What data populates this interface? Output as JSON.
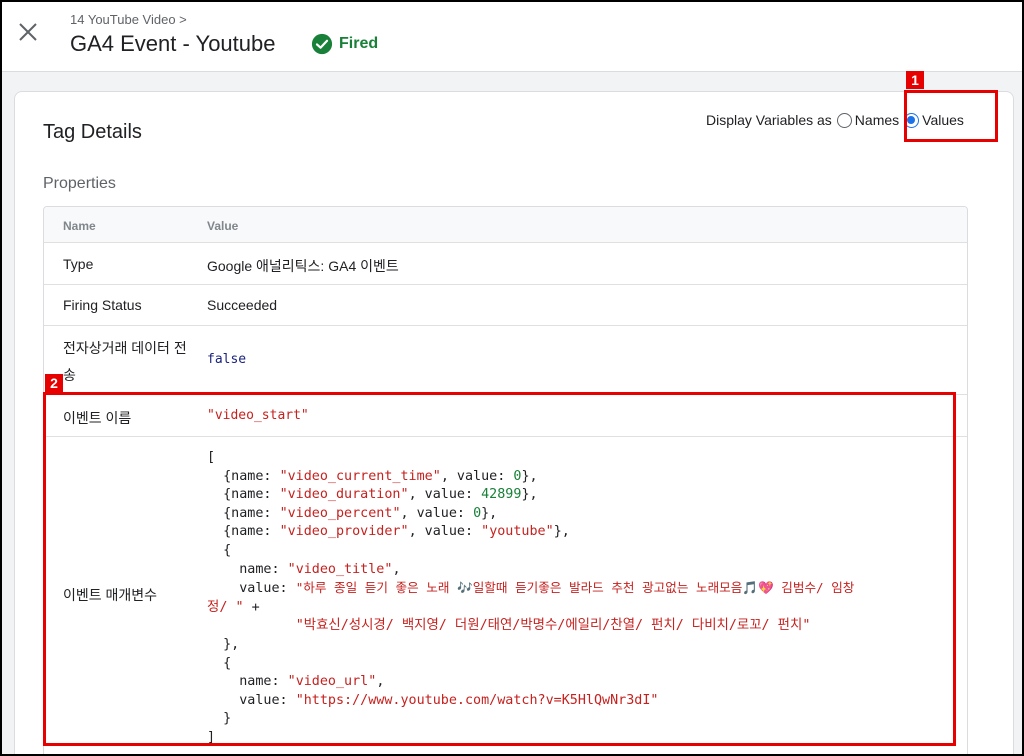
{
  "header": {
    "breadcrumb": "14 YouTube Video >",
    "title": "GA4 Event - Youtube",
    "status": "Fired",
    "status_color": "#188038"
  },
  "card": {
    "title": "Tag Details",
    "display_variables": {
      "label": "Display Variables as",
      "options": [
        "Names",
        "Values"
      ],
      "selected": "Values"
    },
    "section": "Properties",
    "table": {
      "columns": [
        "Name",
        "Value"
      ],
      "rows": [
        {
          "name": "Type",
          "value": "Google 애널리틱스: GA4 이벤트"
        },
        {
          "name": "Firing Status",
          "value": "Succeeded"
        },
        {
          "name": "전자상거래 데이터 전",
          "name_cont": "송",
          "value": "false"
        },
        {
          "name": "이벤트 이름",
          "value": "\"video_start\""
        },
        {
          "name": "이벤트 매개변수"
        }
      ]
    },
    "event_params": {
      "items": [
        {
          "name": "video_current_time",
          "value": "0"
        },
        {
          "name": "video_duration",
          "value": "42899"
        },
        {
          "name": "video_percent",
          "value": "0"
        },
        {
          "name": "video_provider",
          "value": "youtube"
        }
      ],
      "video_title_name": "video_title",
      "video_title_line1": "\"하루 종일 듣기 좋은 노래 🎶일할때 듣기좋은 발라드 추천 광고없는 노래모음🎵💖 김범수/ 임창",
      "video_title_line2": "정/ \"",
      "video_title_line3": "\"박효신/성시경/ 백지영/ 더원/태연/박명수/에일리/찬열/ 펀치/ 다비치/로꼬/ 펀치\"",
      "video_url_name": "video_url",
      "video_url_value": "\"https://www.youtube.com/watch?v=K5HlQwNr3dI\""
    }
  },
  "callouts": [
    "1",
    "2"
  ],
  "icons": {
    "close": "close-icon",
    "fired": "check-circle-icon"
  }
}
